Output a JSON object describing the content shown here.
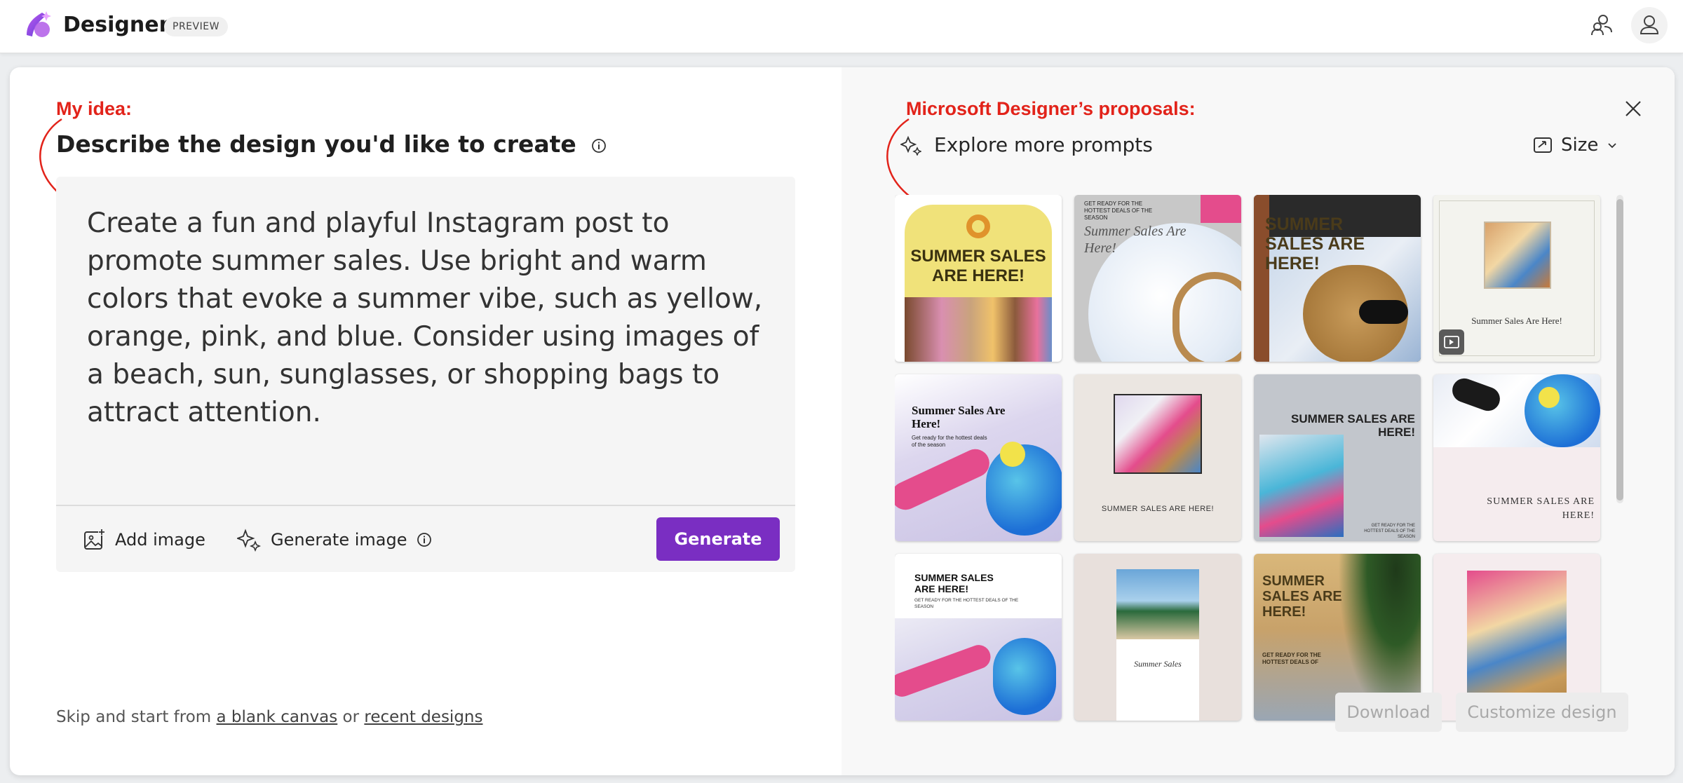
{
  "app": {
    "name": "Designer",
    "badge": "PREVIEW"
  },
  "annotations": {
    "my_idea": "My idea:",
    "proposals": "Microsoft Designer’s proposals:"
  },
  "left": {
    "heading": "Describe the design you'd like to create",
    "prompt": "Create a fun and playful Instagram post to promote summer sales. Use bright and warm colors that evoke a summer vibe, such as yellow, orange, pink, and blue. Consider using images of a beach, sun, sunglasses, or shopping bags to attract attention.",
    "add_image": "Add image",
    "generate_image": "Generate image",
    "generate": "Generate",
    "footer": {
      "prefix": "Skip and start from ",
      "blank_canvas": "a blank canvas",
      "or": " or ",
      "recent_designs": "recent designs"
    }
  },
  "right": {
    "explore": "Explore more prompts",
    "size": "Size",
    "download": "Download",
    "customize": "Customize design",
    "thumbnails": [
      {
        "id": "t1",
        "title": "SUMMER SALES ARE HERE!"
      },
      {
        "id": "t2",
        "kicker": "GET READY FOR THE HOTTEST DEALS OF THE SEASON",
        "title": "Summer Sales Are Here!"
      },
      {
        "id": "t3",
        "title": "SUMMER SALES ARE HERE!"
      },
      {
        "id": "t4",
        "title": "Summer Sales Are Here!"
      },
      {
        "id": "t5",
        "title": "Summer Sales Are Here!",
        "sub": "Get ready for the hottest deals of the season"
      },
      {
        "id": "t6",
        "title": "SUMMER SALES ARE HERE!"
      },
      {
        "id": "t7",
        "title": "SUMMER SALES ARE HERE!",
        "sub": "GET READY FOR THE HOTTEST DEALS OF THE SEASON"
      },
      {
        "id": "t8",
        "title": "SUMMER SALES ARE HERE!"
      },
      {
        "id": "t9",
        "title": "SUMMER SALES ARE HERE!",
        "sub": "GET READY FOR THE HOTTEST DEALS OF THE SEASON"
      },
      {
        "id": "t10",
        "title": "Summer Sales"
      },
      {
        "id": "t11",
        "title": "SUMMER SALES ARE HERE!",
        "sub": "GET READY FOR THE HOTTEST DEALS OF"
      },
      {
        "id": "t12"
      }
    ]
  },
  "colors": {
    "accent": "#7a2ec2",
    "annotation": "#e2231a"
  }
}
